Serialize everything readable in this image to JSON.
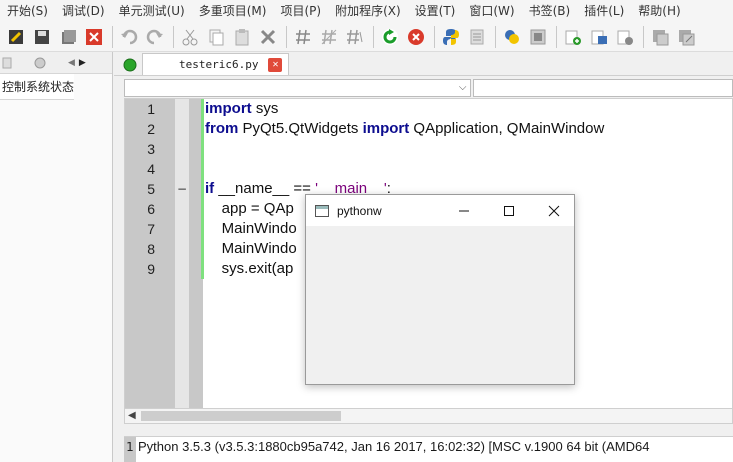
{
  "menubar": {
    "items": [
      "开始(S)",
      "调试(D)",
      "单元测试(U)",
      "多重项目(M)",
      "项目(P)",
      "附加程序(X)",
      "设置(T)",
      "窗口(W)",
      "书签(B)",
      "插件(L)",
      "帮助(H)"
    ]
  },
  "left_panel": {
    "tab_label": "控制系统状态"
  },
  "editor": {
    "tab_filename": "testeric6.py",
    "close_glyph": "✕",
    "combo_arrow": "⌵",
    "lines": [
      {
        "num": "1",
        "parts": [
          {
            "t": "import",
            "k": "kw"
          },
          {
            "t": " sys",
            "k": ""
          }
        ]
      },
      {
        "num": "2",
        "parts": [
          {
            "t": "from",
            "k": "kw"
          },
          {
            "t": " PyQt5.QtWidgets ",
            "k": ""
          },
          {
            "t": "import",
            "k": "kw"
          },
          {
            "t": " QApplication, QMainWindow",
            "k": ""
          }
        ]
      },
      {
        "num": "3",
        "parts": []
      },
      {
        "num": "4",
        "parts": []
      },
      {
        "num": "5",
        "parts": [
          {
            "t": "if",
            "k": "kw"
          },
          {
            "t": " __name__ == ",
            "k": ""
          },
          {
            "t": "'__main__'",
            "k": "str"
          },
          {
            "t": ":",
            "k": ""
          }
        ]
      },
      {
        "num": "6",
        "parts": [
          {
            "t": "    app = QAp",
            "k": ""
          }
        ]
      },
      {
        "num": "7",
        "parts": [
          {
            "t": "    MainWindo",
            "k": ""
          }
        ]
      },
      {
        "num": "8",
        "parts": [
          {
            "t": "    MainWindo",
            "k": ""
          }
        ]
      },
      {
        "num": "9",
        "parts": [
          {
            "t": "    sys.exit(ap",
            "k": ""
          }
        ]
      }
    ],
    "fold_marker": "−"
  },
  "shell": {
    "line_num": "1",
    "text": "Python 3.5.3 (v3.5.3:1880cb95a742, Jan 16 2017, 16:02:32) [MSC v.1900 64 bit (AMD64"
  },
  "popup": {
    "title": "pythonw",
    "minimize_glyph": "—",
    "maximize_glyph": "☐",
    "close_glyph": "✕"
  },
  "colors": {
    "keyword": "#0d0d8f",
    "string": "#7b007b",
    "change_bar": "#7fe07f"
  }
}
